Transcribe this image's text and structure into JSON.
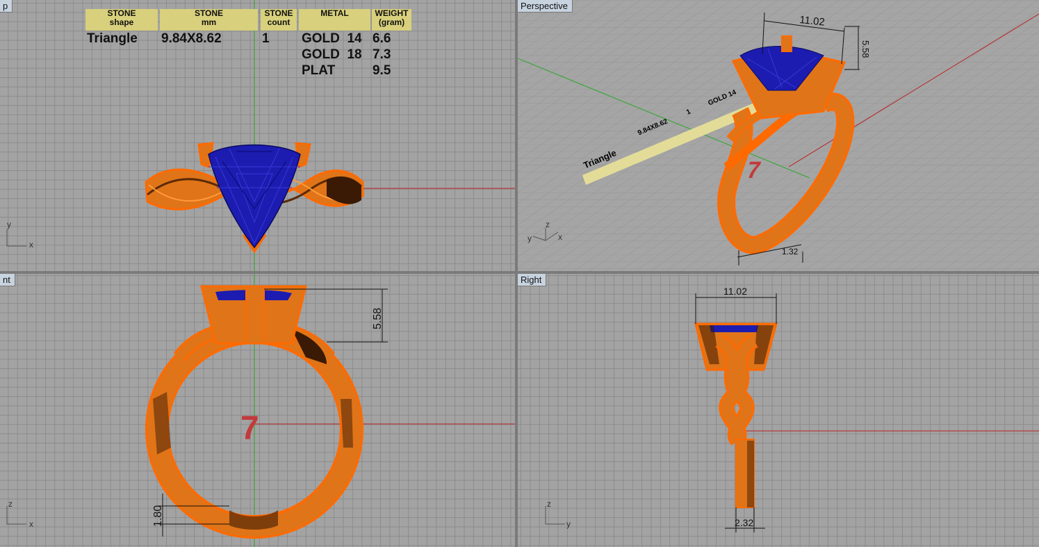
{
  "viewports": {
    "top": {
      "label": "p"
    },
    "perspective": {
      "label": "Perspective"
    },
    "front": {
      "label": "nt"
    },
    "right": {
      "label": "Right"
    }
  },
  "spec_table": {
    "headers": [
      {
        "line1": "STONE",
        "line2": "shape"
      },
      {
        "line1": "STONE",
        "line2": "mm"
      },
      {
        "line1": "STONE",
        "line2": "count"
      },
      {
        "line1": "METAL",
        "line2": ""
      },
      {
        "line1": "WEIGHT",
        "line2": "(gram)"
      }
    ],
    "stone_shape": "Triangle",
    "stone_mm": "9.84X8.62",
    "stone_count": "1",
    "metals": [
      {
        "metal": "GOLD  14",
        "weight": "6.6"
      },
      {
        "metal": "GOLD  18",
        "weight": "7.3"
      },
      {
        "metal": "PLAT",
        "weight": "9.5"
      }
    ]
  },
  "dimensions": {
    "width": "11.02",
    "height": "5.58",
    "band_thickness": "1.80",
    "band_width": "2.32",
    "persp_band": "1.32",
    "ring_size": "7"
  },
  "axes": {
    "x": "x",
    "y": "y",
    "z": "z"
  },
  "colors": {
    "metal": "#e07418",
    "metal_edge": "#ff6a00",
    "stone": "#1c1cb0",
    "dim_line": "#111111",
    "axis_red": "#b43a3a",
    "axis_green": "#3aa63a",
    "header_bg": "#d8d07c"
  }
}
